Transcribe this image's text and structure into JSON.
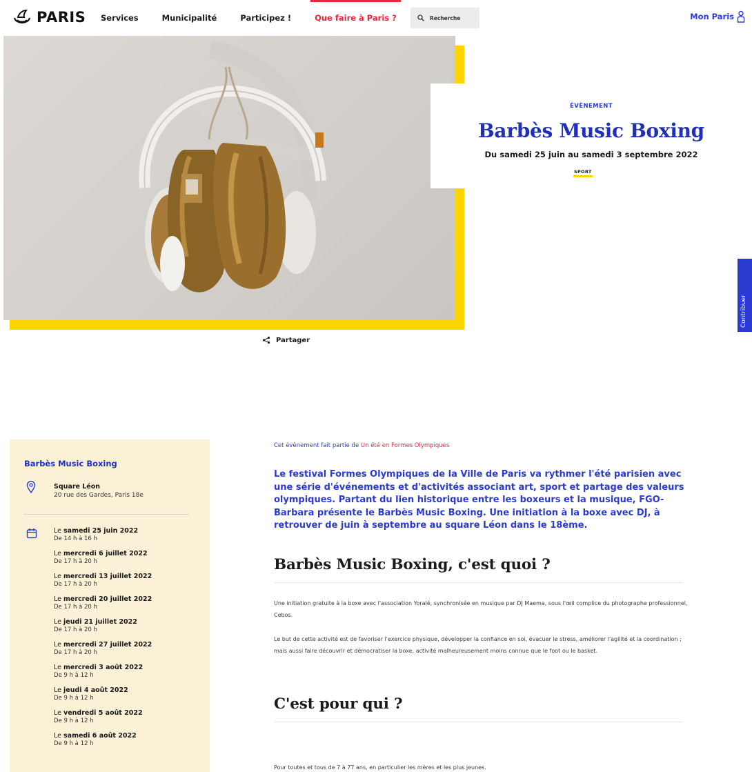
{
  "header": {
    "logo_text": "PARIS",
    "nav": [
      {
        "label": "Services",
        "active": false
      },
      {
        "label": "Municipalité",
        "active": false
      },
      {
        "label": "Participez !",
        "active": false
      },
      {
        "label": "Que faire à Paris ?",
        "active": true
      }
    ],
    "search_label": "Recherche",
    "account_label": "Mon Paris"
  },
  "hero": {
    "kicker": "ÉVÈNEMENT",
    "title": "Barbès Music Boxing",
    "dates": "Du samedi 25 juin au samedi 3 septembre 2022",
    "tag": "SPORT"
  },
  "share_label": "Partager",
  "contribute_label": "Contribuer",
  "sidebar": {
    "title": "Barbès Music Boxing",
    "location_name": "Square Léon",
    "location_address": "20 rue des Gardes, Paris 18e",
    "dates": [
      {
        "prefix": "Le ",
        "day": "samedi 25 juin 2022",
        "time": "De 14 h à 16 h"
      },
      {
        "prefix": "Le ",
        "day": "mercredi 6 juillet 2022",
        "time": "De 17 h à 20 h"
      },
      {
        "prefix": "Le ",
        "day": "mercredi 13 juillet 2022",
        "time": "De 17 h à 20 h"
      },
      {
        "prefix": "Le ",
        "day": "mercredi 20 juillet 2022",
        "time": "De 17 h à 20 h"
      },
      {
        "prefix": "Le ",
        "day": "jeudi 21 juillet 2022",
        "time": "De 17 h à 20 h"
      },
      {
        "prefix": "Le ",
        "day": "mercredi 27 juillet 2022",
        "time": "De 17 h à 20 h"
      },
      {
        "prefix": "Le ",
        "day": "mercredi 3 août 2022",
        "time": "De 9 h à 12 h"
      },
      {
        "prefix": "Le ",
        "day": "jeudi 4 août 2022",
        "time": "De 9 h à 12 h"
      },
      {
        "prefix": "Le ",
        "day": "vendredi 5 août 2022",
        "time": "De 9 h à 12 h"
      },
      {
        "prefix": "Le ",
        "day": "samedi 6 août 2022",
        "time": "De 9 h à 12 h"
      }
    ]
  },
  "content": {
    "part_of_prefix": "Cet évènement fait partie de ",
    "part_of_link": "Un été en Formes Olympiques",
    "lead": "Le festival Formes Olympiques de la Ville de Paris va rythmer l'été parisien avec une série d'événements et d'activités associant art, sport et partage des valeurs olympiques. Partant du lien historique entre les boxeurs et la musique, FGO-Barbara présente le Barbès Music Boxing. Une initiation à la boxe avec DJ, à retrouver de juin à septembre au square Léon dans le 18ème.",
    "h2_1": "Barbès Music Boxing, c'est quoi ?",
    "p1": "Une initiation gratuite à la boxe avec l'association Yoralé, synchronisée en musique par DJ Maema, sous l'œil complice du photographe professionnel, Cebos.",
    "p2": "Le but de cette activité est de favoriser l'exercice physique, développer la confiance en soi, évacuer le stress, améliorer l'agilité et la coordination ; mais aussi faire découvrir et démocratiser la boxe, activité malheureusement moins connue que le foot ou le basket.",
    "h2_2": "C'est pour qui ?",
    "p3": "Pour toutes et tous de 7 à 77 ans, en particulier les mères et les plus jeunes."
  },
  "colors": {
    "brand_blue": "#2b3bd1",
    "accent_red": "#e4293f",
    "accent_yellow": "#ffd500",
    "sidebar_bg": "#fbf1d7"
  }
}
